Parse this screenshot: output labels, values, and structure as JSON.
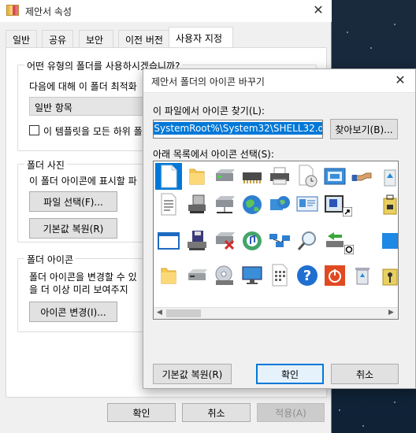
{
  "window": {
    "title": "제안서 속성",
    "close_glyph": "✕"
  },
  "tabs": [
    {
      "label": "일반"
    },
    {
      "label": "공유"
    },
    {
      "label": "보안"
    },
    {
      "label": "이전 버전"
    },
    {
      "label": "사용자 지정",
      "active": true
    }
  ],
  "folder_type": {
    "question": "어떤 유형의 폴더를 사용하시겠습니까?",
    "optimize_label": "다음에 대해 이 폴더 최적화",
    "selected_value": "일반 항목",
    "checkbox_label": "이 템플릿을 모든 하위 폴더",
    "checkbox_checked": false
  },
  "folder_pictures": {
    "title": "폴더 사진",
    "description": "이 폴더 아이콘에 표시할 파",
    "choose_file_button": "파일 선택(F)...",
    "restore_default_button": "기본값 복원(R)"
  },
  "folder_icons": {
    "title": "폴더 아이콘",
    "line1": "폴더 아이콘을 변경할 수 있",
    "line2": "을 더 이상  미리 보여주지",
    "change_icon_button": "아이콘 변경(I)..."
  },
  "footer": {
    "ok": "확인",
    "cancel": "취소",
    "apply": "적용(A)"
  },
  "dialog": {
    "title": "제안서 폴더의 아이콘 바꾸기",
    "close_glyph": "✕",
    "find_label": "이 파일에서 아이콘 찾기(L):",
    "path_value": "%SystemRoot%\\System32\\SHELL32.dll",
    "browse_button": "찾아보기(B)...",
    "list_label": "아래 목록에서 아이콘 선택(S):",
    "restore_button": "기본값 복원(R)",
    "ok_button": "확인",
    "cancel_button": "취소",
    "icons": [
      "blank-document-icon",
      "folder-icon",
      "hard-drive-icon",
      "memory-chip-icon",
      "printer-icon",
      "document-clock-icon",
      "application-window-icon",
      "hand-share-icon",
      "recycle-icon",
      "text-document-icon",
      "network-drive-icon",
      "network-drive-2-icon",
      "globe-icon",
      "network-globe-icon",
      "monitor-id-icon",
      "shortcut-doc-icon",
      "shortcut-arrow-icon",
      "briefcase-icon",
      "window-icon",
      "floppy-stack-icon",
      "drive-error-icon",
      "cd-music-icon",
      "network-nodes-icon",
      "magnifier-icon",
      "network-green-icon",
      "clock-shortcut-icon",
      "blue-square-icon",
      "folder-yellow-icon",
      "drive-gray-icon",
      "cd-rom-icon",
      "monitor-blue-icon",
      "grid-document-icon",
      "help-question-icon",
      "power-button-icon",
      "trash-full-icon",
      "key-folder-icon"
    ]
  }
}
